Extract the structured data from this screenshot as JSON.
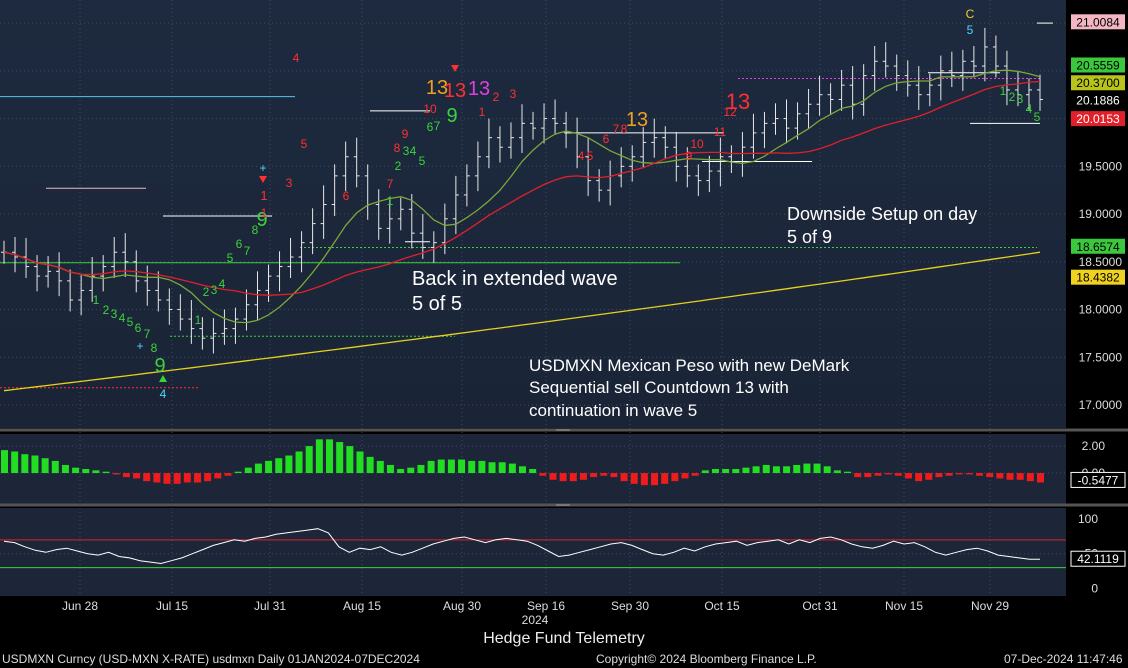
{
  "chart_data": [
    {
      "type": "candlestick",
      "panel": "price",
      "y_ticks": [
        "17.0000",
        "17.5000",
        "18.0000",
        "18.5000",
        "19.0000",
        "19.5000"
      ],
      "ylim": [
        16.78,
        21.2
      ],
      "price_labels": [
        {
          "value": 21.0084,
          "text": "21.0084",
          "bg": "#f4b6c2",
          "fg": "#000"
        },
        {
          "value": 20.5559,
          "text": "20.5559",
          "bg": "#3cc83c",
          "fg": "#000"
        },
        {
          "value": 20.37,
          "text": "20.3700",
          "bg": "#b9c41a",
          "fg": "#000"
        },
        {
          "value": 20.1886,
          "text": "20.1886",
          "bg": "#000000",
          "fg": "#fff"
        },
        {
          "value": 20.0153,
          "text": "20.0153",
          "bg": "#e0202a",
          "fg": "#fff"
        },
        {
          "value": 18.6574,
          "text": "18.6574",
          "bg": "#3cc83c",
          "fg": "#000"
        },
        {
          "value": 18.4382,
          "text": "18.4382",
          "bg": "#f0d020",
          "fg": "#000"
        }
      ],
      "x_labels": [
        "Jun 28",
        "Jul 15",
        "Jul 31",
        "Aug 15",
        "Aug 30",
        "Sep 16",
        "Sep 30",
        "Oct 15",
        "Oct 31",
        "Nov 15",
        "Nov 29"
      ],
      "year_label": "2024",
      "annotations": [
        "Downside Setup on day",
        "5 of 9",
        "Back in extended wave",
        "5 of 5",
        "USDMXN Mexican Peso with new DeMark",
        "Sequential sell Countdown 13 with",
        "continuation in wave 5"
      ],
      "demark_labels": [
        {
          "t": "9",
          "c": "#3cd23c",
          "s": 20
        },
        {
          "t": "4",
          "c": "#4fd4ff",
          "s": 12
        },
        {
          "t": "9",
          "c": "#3cd23c",
          "s": 20
        },
        {
          "t": "1",
          "c": "#ff3030",
          "s": 13
        },
        {
          "t": "4",
          "c": "#ff3030",
          "s": 12
        },
        {
          "t": "13",
          "c": "#f0a020",
          "s": 20
        },
        {
          "t": "13",
          "c": "#ff3030",
          "s": 20
        },
        {
          "t": "13",
          "c": "#e040e0",
          "s": 20
        },
        {
          "t": "9",
          "c": "#3cd23c",
          "s": 20
        },
        {
          "t": "13",
          "c": "#f0a020",
          "s": 20
        },
        {
          "t": "13",
          "c": "#ff3030",
          "s": 22
        },
        {
          "t": "C",
          "c": "#f0d020",
          "s": 12
        },
        {
          "t": "5",
          "c": "#4fd4ff",
          "s": 12
        }
      ],
      "close_approx": [
        18.6,
        18.55,
        18.45,
        18.35,
        18.4,
        18.3,
        18.1,
        18.2,
        18.35,
        18.45,
        18.6,
        18.5,
        18.3,
        18.2,
        18.1,
        18.0,
        17.9,
        17.8,
        17.7,
        17.75,
        17.8,
        17.9,
        18.05,
        18.2,
        18.35,
        18.45,
        18.55,
        18.7,
        18.9,
        19.1,
        19.4,
        19.6,
        19.4,
        19.1,
        18.85,
        18.95,
        19.05,
        18.8,
        18.65,
        18.7,
        18.95,
        19.2,
        19.4,
        19.6,
        19.8,
        19.7,
        19.8,
        19.95,
        19.9,
        20.0,
        19.95,
        19.85,
        19.6,
        19.35,
        19.25,
        19.4,
        19.5,
        19.6,
        19.75,
        19.8,
        19.7,
        19.5,
        19.4,
        19.35,
        19.45,
        19.6,
        19.55,
        19.7,
        19.85,
        19.95,
        20.0,
        19.9,
        20.05,
        20.15,
        20.25,
        20.2,
        20.35,
        20.15,
        20.45,
        20.6,
        20.55,
        20.45,
        20.35,
        20.25,
        20.35,
        20.5,
        20.45,
        20.6,
        20.55,
        20.75,
        20.55,
        20.3,
        20.25,
        20.3,
        20.2
      ],
      "series": [
        {
          "name": "",
          "color": "#e0202a"
        },
        {
          "name": "",
          "color": "#e6d21c"
        },
        {
          "name": "",
          "color": "#7aa83a"
        }
      ]
    },
    {
      "type": "bar",
      "panel": "macd_histogram",
      "y_ticks": [
        "2.00",
        "0.00"
      ],
      "ylim": [
        -2.0,
        2.6
      ],
      "last_label": "-0.5477",
      "values": [
        1.7,
        1.6,
        1.4,
        1.3,
        1.1,
        0.9,
        0.6,
        0.4,
        0.3,
        0.2,
        0.1,
        -0.1,
        -0.3,
        -0.4,
        -0.6,
        -0.7,
        -0.8,
        -0.8,
        -0.7,
        -0.7,
        -0.6,
        -0.4,
        -0.2,
        0.1,
        0.4,
        0.7,
        0.9,
        1.1,
        1.3,
        1.6,
        2.0,
        2.5,
        2.5,
        2.3,
        2.0,
        1.6,
        1.2,
        0.9,
        0.6,
        0.3,
        0.4,
        0.6,
        0.9,
        1.0,
        1.0,
        1.0,
        0.9,
        0.9,
        0.8,
        0.8,
        0.7,
        0.5,
        0.3,
        -0.2,
        -0.5,
        -0.6,
        -0.6,
        -0.5,
        -0.3,
        -0.2,
        -0.3,
        -0.6,
        -0.8,
        -0.9,
        -0.9,
        -0.8,
        -0.6,
        -0.4,
        -0.2,
        0.2,
        0.3,
        0.3,
        0.3,
        0.4,
        0.5,
        0.6,
        0.5,
        0.5,
        0.6,
        0.7,
        0.7,
        0.5,
        0.2,
        0.1,
        -0.3,
        -0.3,
        -0.2,
        -0.1,
        -0.2,
        -0.4,
        -0.6,
        -0.5,
        -0.3,
        -0.2,
        -0.1,
        -0.1,
        -0.2,
        -0.3,
        -0.4,
        -0.5,
        -0.5,
        -0.6,
        -0.7
      ]
    },
    {
      "type": "line",
      "panel": "oscillator",
      "y_ticks": [
        "100",
        "50",
        "0"
      ],
      "ylim": [
        -5,
        110
      ],
      "upper_band": 70,
      "lower_band": 30,
      "last_label": "42.1119",
      "values": [
        68,
        66,
        60,
        55,
        52,
        56,
        58,
        54,
        50,
        48,
        52,
        46,
        44,
        40,
        38,
        36,
        40,
        44,
        50,
        56,
        62,
        66,
        70,
        68,
        72,
        74,
        78,
        80,
        82,
        84,
        86,
        80,
        60,
        52,
        58,
        56,
        60,
        52,
        48,
        52,
        58,
        64,
        68,
        72,
        74,
        70,
        66,
        70,
        72,
        70,
        68,
        62,
        54,
        46,
        48,
        52,
        56,
        60,
        64,
        66,
        62,
        56,
        50,
        48,
        52,
        58,
        54,
        60,
        64,
        66,
        68,
        62,
        66,
        68,
        70,
        64,
        70,
        66,
        72,
        74,
        70,
        64,
        60,
        58,
        62,
        68,
        64,
        66,
        60,
        52,
        48,
        52,
        56,
        58,
        54,
        48,
        46,
        44,
        42,
        42
      ]
    }
  ],
  "footer": {
    "hedge": "Hedge Fund Telemetry",
    "left": "USDMXN Curncy (USD-MXN X-RATE) usdmxn  Daily 01JAN2024-07DEC2024",
    "copyright": "Copyright© 2024 Bloomberg Finance L.P.",
    "timestamp": "07-Dec-2024 11:47:46"
  }
}
